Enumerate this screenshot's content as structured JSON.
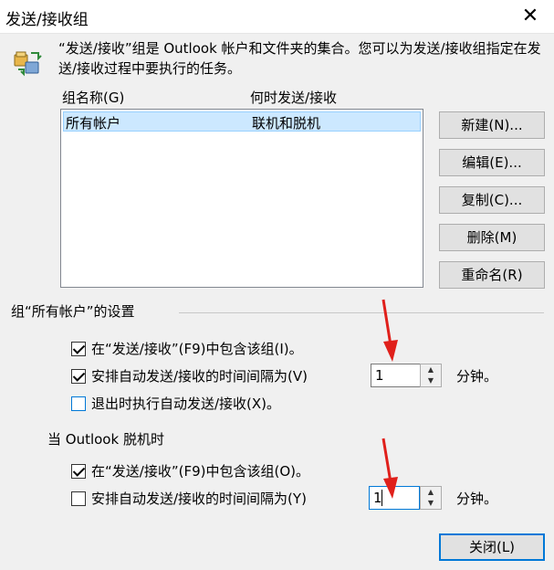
{
  "window": {
    "title": "发送/接收组",
    "close_glyph": "✕"
  },
  "intro": "“发送/接收”组是 Outlook 帐户和文件夹的集合。您可以为发送/接收组指定在发送/接收过程中要执行的任务。",
  "list": {
    "headers": [
      "组名称(G)",
      "何时发送/接收"
    ],
    "rows": [
      {
        "name": "所有帐户",
        "when": "联机和脱机",
        "selected": true
      }
    ]
  },
  "buttons": {
    "new": "新建(N)...",
    "edit": "编辑(E)...",
    "copy": "复制(C)...",
    "delete": "删除(M)",
    "rename": "重命名(R)",
    "close": "关闭(L)"
  },
  "online_group": {
    "label": "组“所有帐户”的设置",
    "include": {
      "label": "在“发送/接收”(F9)中包含该组(I)。",
      "checked": true
    },
    "schedule": {
      "label": "安排自动发送/接收的时间间隔为(V)",
      "checked": true,
      "value": "1",
      "unit": "分钟。"
    },
    "on_exit": {
      "label": "退出时执行自动发送/接收(X)。",
      "checked": false
    }
  },
  "offline_group": {
    "label": "当 Outlook 脱机时",
    "include": {
      "label": "在“发送/接收”(F9)中包含该组(O)。",
      "checked": true
    },
    "schedule": {
      "label": "安排自动发送/接收的时间间隔为(Y)",
      "checked": false,
      "value": "1",
      "unit": "分钟。"
    }
  },
  "colors": {
    "accent": "#0078d7",
    "selection": "#cce8ff",
    "annotation": "#e0201b"
  }
}
